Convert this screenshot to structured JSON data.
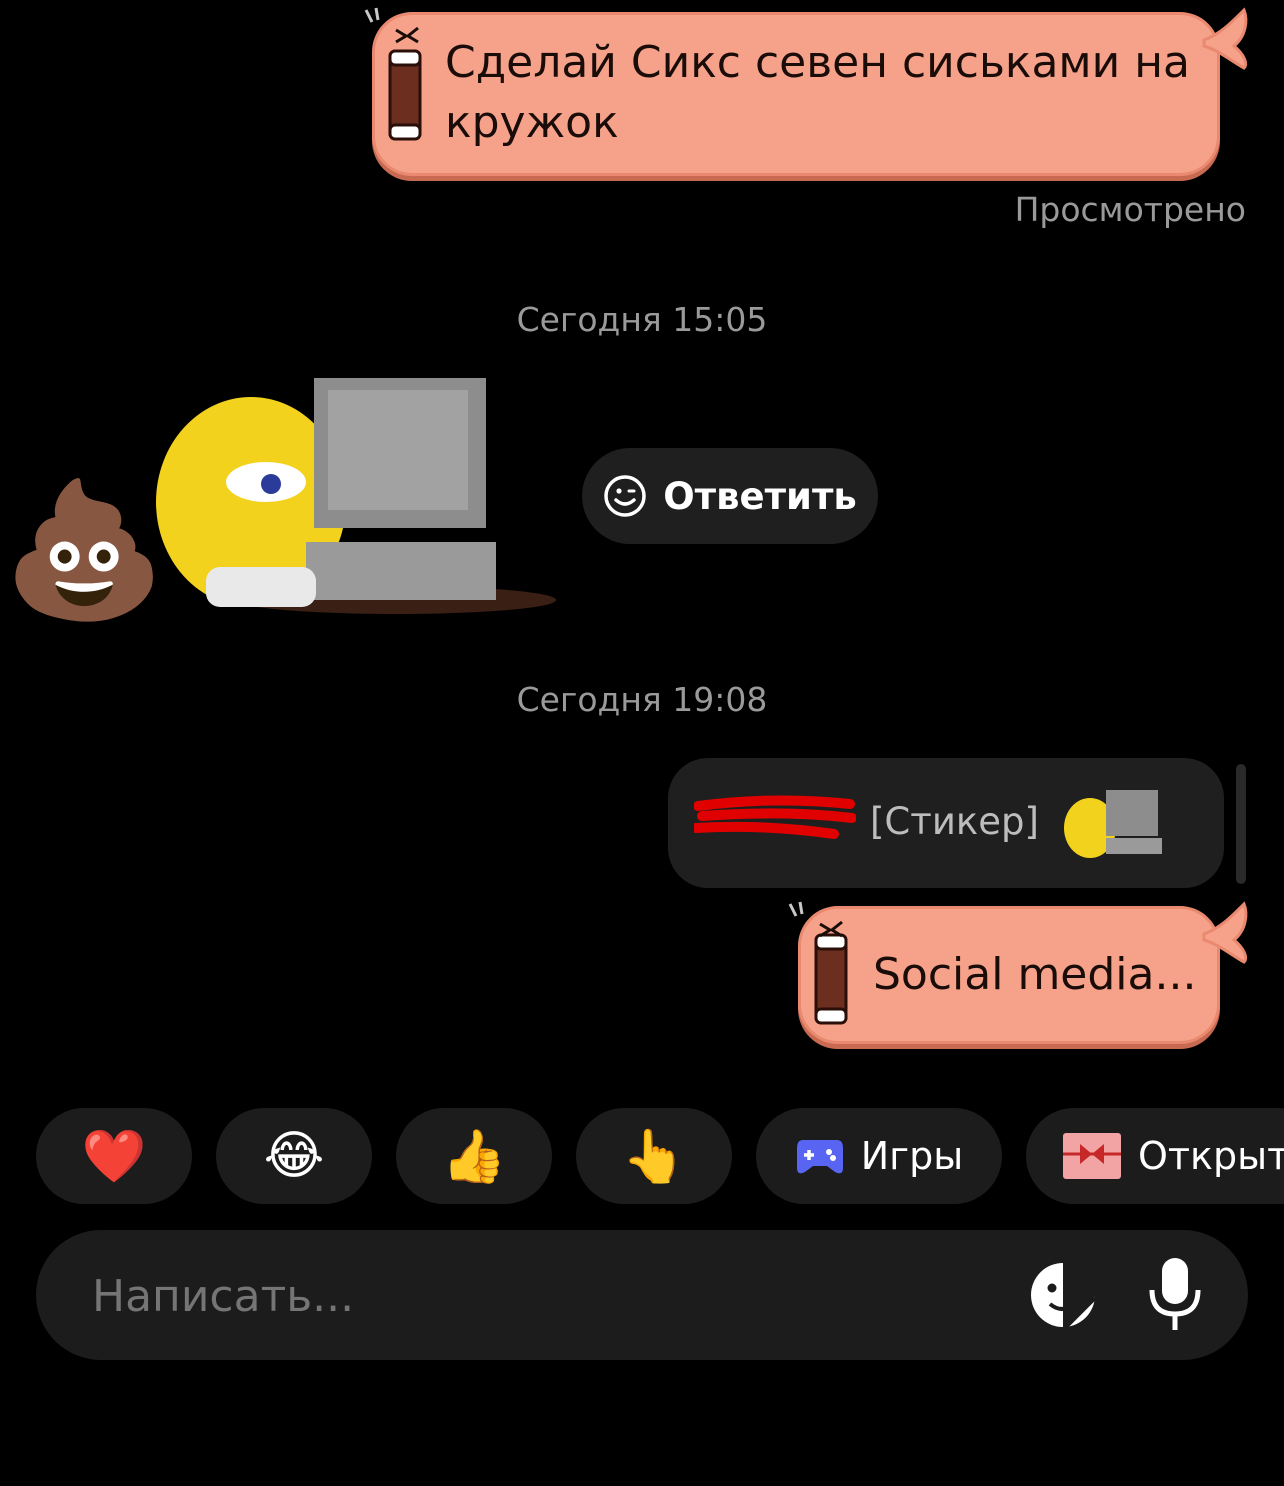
{
  "messages": {
    "m1_text": "Сделай Сикс севен сиськами на кружок",
    "m1_status": "Просмотрено",
    "m2_text": "Social media..."
  },
  "timestamps": {
    "t1": "Сегодня 15:05",
    "t2": "Сегодня 19:08"
  },
  "reply_button": {
    "label": "Ответить",
    "icon": "smile-icon"
  },
  "reply_preview": {
    "sender": "",
    "text": "[Стикер]"
  },
  "quick_chips": [
    {
      "emoji": "❤️",
      "icon": "heart-icon"
    },
    {
      "emoji": "😂",
      "icon": "laugh-icon"
    },
    {
      "emoji": "👍",
      "icon": "thumbs-up-icon"
    },
    {
      "emoji": "👆",
      "icon": "pointing-hand-icon"
    },
    {
      "label": "Игры",
      "icon": "gamepad-icon"
    },
    {
      "label": "Открыт",
      "icon": "gift-card-icon"
    }
  ],
  "composer": {
    "placeholder": "Написать...",
    "sticker_icon": "sticker-icon",
    "mic_icon": "mic-icon"
  },
  "colors": {
    "bubble": "#f6a28b",
    "bubble_border": "#e9896f",
    "chip_bg": "#1c1c1c",
    "accent_game": "#5865f2"
  }
}
